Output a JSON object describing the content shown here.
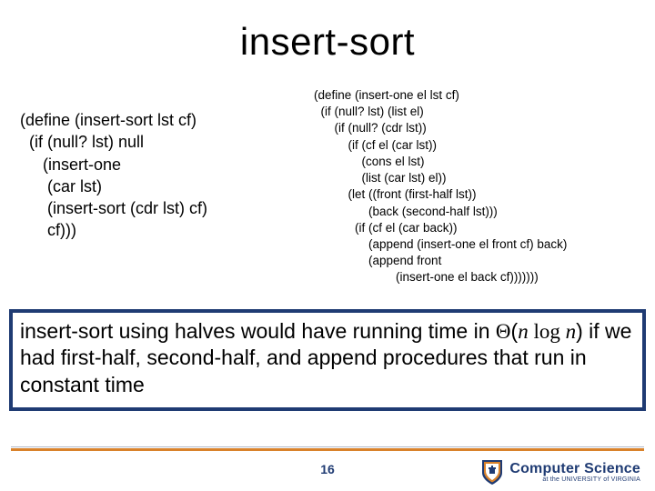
{
  "title": "insert-sort",
  "code_left": "(define (insert-sort lst cf)\n  (if (null? lst) null\n     (insert-one\n      (car lst)\n      (insert-sort (cdr lst) cf)\n      cf)))",
  "code_right": "(define (insert-one el lst cf)\n  (if (null? lst) (list el)\n      (if (null? (cdr lst))\n          (if (cf el (car lst))\n              (cons el lst)\n              (list (car lst) el))\n          (let ((front (first-half lst))\n                (back (second-half lst)))\n            (if (cf el (car back))\n                (append (insert-one el front cf) back)\n                (append front\n                        (insert-one el back cf)))))))",
  "callout": {
    "pre": "insert-sort using halves would have running time in ",
    "theta": "Θ",
    "lparen": "(",
    "n1": "n",
    "log": " log ",
    "n2": "n",
    "rparen": ")",
    "post": " if we had first-half, second-half, and append procedures that run in constant time"
  },
  "pagenum": "16",
  "logo": {
    "line1": "Computer Science",
    "line2": "at the UNIVERSITY of VIRGINIA"
  }
}
